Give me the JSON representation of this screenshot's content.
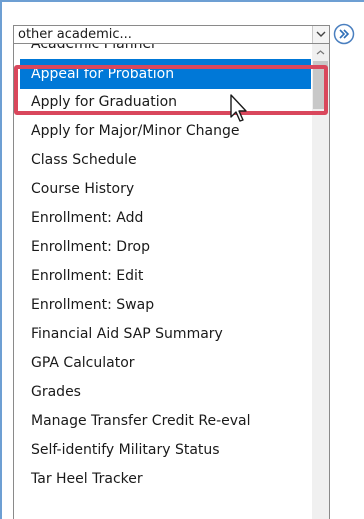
{
  "select": {
    "value": "other academic..."
  },
  "dropdown": {
    "items": [
      {
        "label": "Academic Planner",
        "selected": false
      },
      {
        "label": "Appeal for Probation",
        "selected": true
      },
      {
        "label": "Apply for Graduation",
        "selected": false
      },
      {
        "label": "Apply for Major/Minor Change",
        "selected": false
      },
      {
        "label": "Class Schedule",
        "selected": false
      },
      {
        "label": "Course History",
        "selected": false
      },
      {
        "label": "Enrollment: Add",
        "selected": false
      },
      {
        "label": "Enrollment: Drop",
        "selected": false
      },
      {
        "label": "Enrollment: Edit",
        "selected": false
      },
      {
        "label": "Enrollment: Swap",
        "selected": false
      },
      {
        "label": "Financial Aid SAP Summary",
        "selected": false
      },
      {
        "label": "GPA Calculator",
        "selected": false
      },
      {
        "label": "Grades",
        "selected": false
      },
      {
        "label": "Manage Transfer Credit Re-eval",
        "selected": false
      },
      {
        "label": "Self-identify Military Status",
        "selected": false
      },
      {
        "label": "Tar Heel Tracker",
        "selected": false
      }
    ]
  },
  "colors": {
    "selection": "#0078d7",
    "highlight_border": "#d9475c",
    "frame_border": "#6d9fd3"
  },
  "icons": {
    "select_arrow": "chevron-down-icon",
    "go_button": "double-chevron-right-icon",
    "cursor": "mouse-pointer-icon"
  }
}
